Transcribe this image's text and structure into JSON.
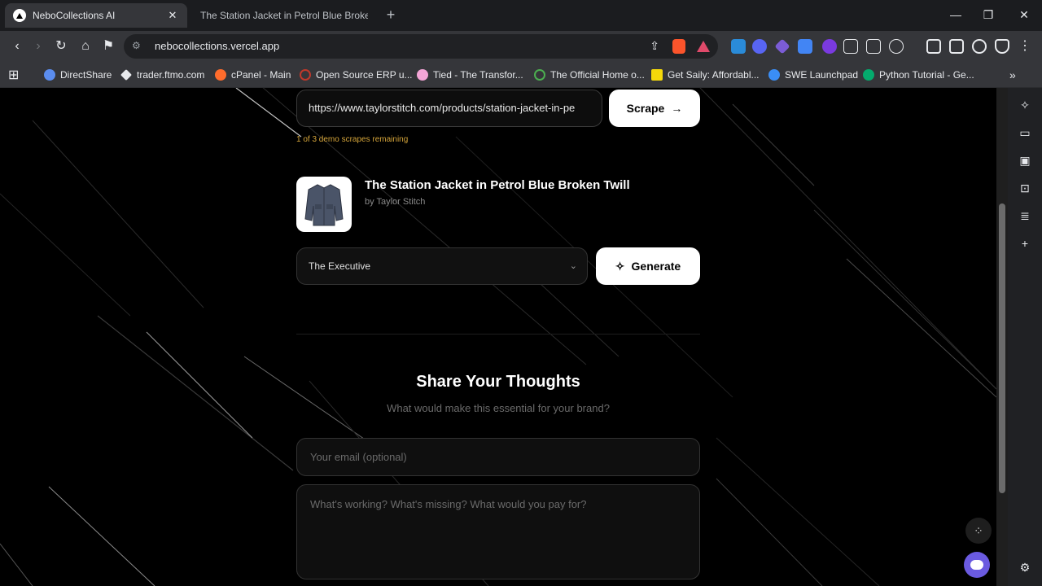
{
  "browser": {
    "tabs": [
      {
        "title": "NeboCollections AI",
        "active": true
      },
      {
        "title": "The Station Jacket in Petrol Blue Broken Twill",
        "active": false
      }
    ],
    "address": "nebocollections.vercel.app",
    "bookmarks": [
      {
        "label": "DirectShare",
        "color": "#5b8def"
      },
      {
        "label": "trader.ftmo.com",
        "color": "#e8eaed"
      },
      {
        "label": "cPanel - Main",
        "color": "#ff6c2c"
      },
      {
        "label": "Open Source ERP u...",
        "color": "#c0392b"
      },
      {
        "label": "Tied - The Transfor...",
        "color": "#f4a6d7"
      },
      {
        "label": "The Official Home o...",
        "color": "#4caf50"
      },
      {
        "label": "Get Saily: Affordabl...",
        "color": "#f5d90a"
      },
      {
        "label": "SWE Launchpad",
        "color": "#3a8ef6"
      },
      {
        "label": "Python Tutorial - Ge...",
        "color": "#04aa6d"
      }
    ]
  },
  "scraper": {
    "url_value": "https://www.taylorstitch.com/products/station-jacket-in-pe",
    "scrape_label": "Scrape",
    "remaining": "1 of 3 demo scrapes remaining"
  },
  "product": {
    "title": "The Station Jacket in Petrol Blue Broken Twill",
    "brand": "by Taylor Stitch"
  },
  "generator": {
    "selected_style": "The Executive",
    "generate_label": "Generate"
  },
  "feedback": {
    "title": "Share Your Thoughts",
    "subtitle": "What would make this essential for your brand?",
    "email_placeholder": "Your email (optional)",
    "message_placeholder": "What's working? What's missing? What would you pay for?"
  },
  "colors": {
    "accent_remaining": "#d4a43a",
    "button_bg": "#ffffff",
    "page_bg": "#000000"
  }
}
